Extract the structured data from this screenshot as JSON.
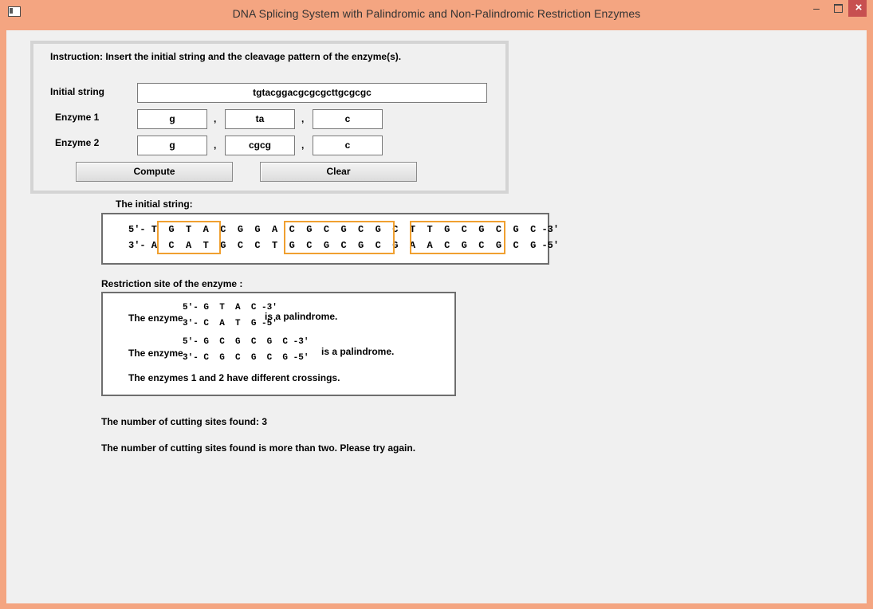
{
  "window": {
    "title": "DNA Splicing System with Palindromic and Non-Palindromic Restriction Enzymes"
  },
  "form": {
    "instruction": "Instruction: Insert the initial string and the cleavage pattern of the enzyme(s).",
    "initial_string_label": "Initial string",
    "initial_string_value": "tgtacggacgcgcgcttgcgcgc",
    "enzyme1_label": "Enzyme 1",
    "enzyme1": [
      "g",
      "ta",
      "c"
    ],
    "enzyme2_label": "Enzyme 2",
    "enzyme2": [
      "g",
      "cgcg",
      "c"
    ],
    "separator": ",",
    "compute_label": "Compute",
    "clear_label": "Clear"
  },
  "initial": {
    "heading": "The initial string:",
    "top": "5'- T  G  T  A  C  G  G  A  C  G  C  G  C  G  C  T  T  G  C  G  C  G  C -3'",
    "bottom": "3'- A  C  A  T  G  C  C  T  G  C  G  C  G  C  G  A  A  C  G  C  G  C  G -5'",
    "highlight_color": "#f0a030"
  },
  "restriction": {
    "heading": "Restriction site of the enzyme :",
    "prefix": "The enzyme",
    "enzyme1_top": "5'- G  T  A  C -3'",
    "enzyme1_bottom": "3'- C  A  T  G -5'",
    "enzyme1_note": "is a palindrome.",
    "enzyme2_top": "5'- G  C  G  C  G  C -3'",
    "enzyme2_bottom": "3'- C  G  C  G  C  G -5'",
    "enzyme2_note": "is a palindrome.",
    "crossing_note": "The enzymes 1 and 2 have different crossings."
  },
  "results": {
    "count_text": "The number of cutting sites found: 3",
    "message": "The number of cutting sites found is more than two.  Please try again."
  }
}
